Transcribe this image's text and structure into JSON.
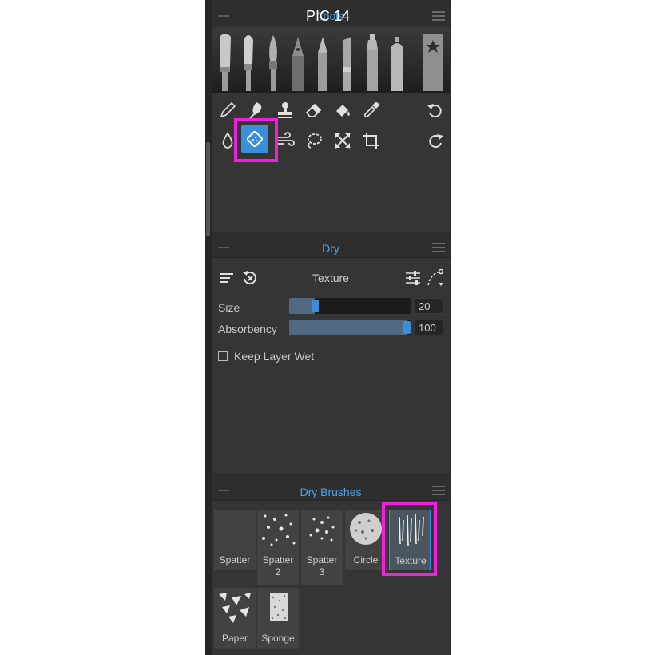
{
  "overlay_caption": "PIC 14",
  "tools_panel": {
    "title": "Tools",
    "brushes": [
      "brush-wide-icon",
      "brush-round-icon",
      "brush-pointed-icon",
      "nib-pen-icon",
      "pencil-icon",
      "pastel-icon",
      "marker-icon",
      "spray-can-icon",
      "favorites-bookmark-icon"
    ],
    "tool_row_1": [
      "pencil-tool-icon",
      "smudge-tool-icon",
      "stamp-tool-icon",
      "eraser-tool-icon",
      "fill-tool-icon",
      "eyedropper-tool-icon",
      "undo-icon"
    ],
    "tool_row_2": [
      "drop-tool-icon",
      "dry-tool-icon",
      "blow-tool-icon",
      "lasso-tool-icon",
      "transform-tool-icon",
      "crop-tool-icon",
      "redo-icon"
    ],
    "active_tool": "dry-tool-icon"
  },
  "dry_panel": {
    "title": "Dry",
    "preset_name": "Texture",
    "size_label": "Size",
    "size_value": "20",
    "size_level": 0.2,
    "absorbency_label": "Absorbency",
    "absorbency_value": "100",
    "absorbency_level": 1.0,
    "keep_wet_label": "Keep Layer Wet",
    "keep_wet_checked": false
  },
  "dry_brushes_panel": {
    "title": "Dry Brushes",
    "tiles": [
      {
        "label": "Spatter",
        "selected": false
      },
      {
        "label": "Spatter 2",
        "selected": false
      },
      {
        "label": "Spatter 3",
        "selected": false
      },
      {
        "label": "Circle",
        "selected": false
      },
      {
        "label": "Texture",
        "selected": true
      },
      {
        "label": "Paper",
        "selected": false
      },
      {
        "label": "Sponge",
        "selected": false
      }
    ]
  },
  "colors": {
    "accent": "#3b8fd8",
    "title_text": "#4ea3e6",
    "highlight": "#ee22dd",
    "panel_bg": "#353535"
  }
}
